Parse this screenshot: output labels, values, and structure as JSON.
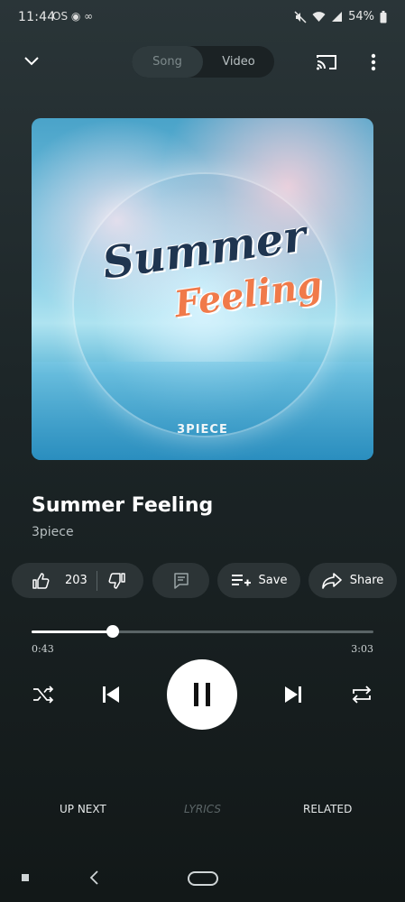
{
  "status": {
    "time": "11:44",
    "left_icons": "OS ◉ ∞",
    "battery": "54%"
  },
  "header": {
    "toggle": {
      "song": "Song",
      "video": "Video"
    }
  },
  "artwork": {
    "title_line1": "Summer",
    "title_line2": "Feeling",
    "brand": "3PIECE"
  },
  "track": {
    "title": "Summer Feeling",
    "artist": "3piece"
  },
  "actions": {
    "like_count": "203",
    "save_label": "Save",
    "share_label": "Share"
  },
  "playback": {
    "elapsed": "0:43",
    "duration": "3:03",
    "progress": 0.237
  },
  "tabs": {
    "up_next": "UP NEXT",
    "lyrics": "LYRICS",
    "related": "RELATED"
  },
  "colors": {
    "background": "#1c2527",
    "pill": "#2c3436",
    "accent_orange": "#f07a4a",
    "accent_navy": "#1f3550"
  }
}
